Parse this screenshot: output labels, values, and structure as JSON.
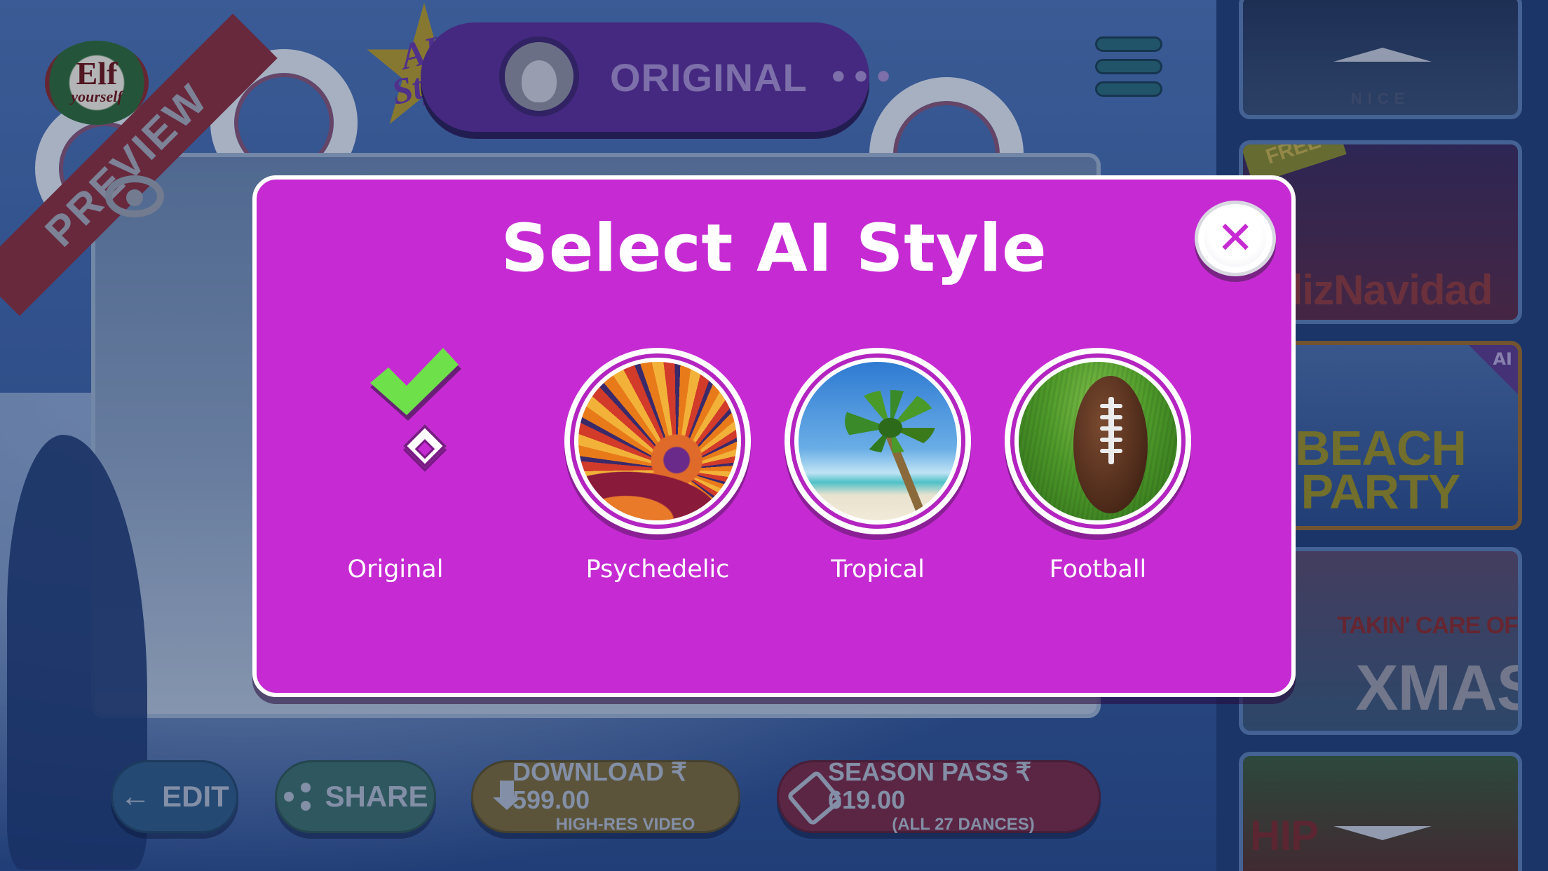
{
  "app": {
    "logo_line1": "Elf",
    "logo_line2": "yourself"
  },
  "header": {
    "ai_badge_text": "AI Style",
    "current_style_label": "ORIGINAL",
    "more_label": "•••"
  },
  "preview": {
    "ribbon_text": "PREVIEW"
  },
  "bottom_bar": {
    "edit_label": "EDIT",
    "share_label": "SHARE",
    "download_label": "DOWNLOAD ₹ 599.00",
    "download_sub": "HIGH-RES VIDEO",
    "season_pass_label": "SEASON PASS ₹ 619.00",
    "season_pass_sub": "(ALL 27 DANCES)"
  },
  "sidebar": {
    "items": [
      {
        "label": "NICE"
      },
      {
        "label": "elizNavidad",
        "badge": "FREE"
      },
      {
        "label": "BEACH PARTY",
        "badge": "AI"
      },
      {
        "label": "XMAS",
        "sublabel": "TAKIN' CARE OF"
      },
      {
        "label": "HIP"
      }
    ]
  },
  "modal": {
    "title": "Select AI Style",
    "close_symbol": "✕",
    "options": [
      {
        "label": "Original",
        "selected": true
      },
      {
        "label": "Psychedelic",
        "selected": false
      },
      {
        "label": "Tropical",
        "selected": false
      },
      {
        "label": "Football",
        "selected": false
      }
    ]
  },
  "colors": {
    "modal_bg": "#c62bd3",
    "check_green": "#6ee04a",
    "overlay_tint": "#0a1e46"
  }
}
